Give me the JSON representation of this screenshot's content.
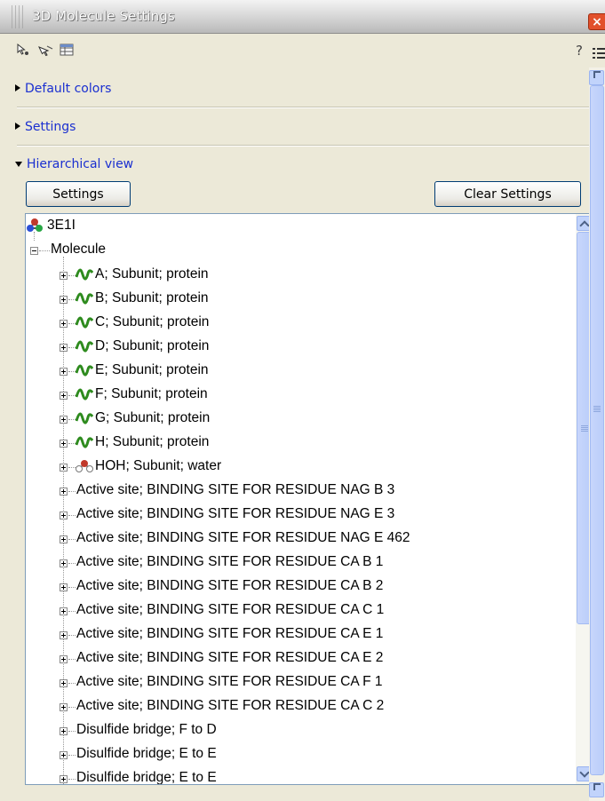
{
  "window": {
    "title": "3D Molecule Settings",
    "close_label": "×"
  },
  "toolbar": {
    "help_label": "?",
    "icons": [
      "pointer-select-icon",
      "pointer-drag-icon",
      "table-view-icon"
    ]
  },
  "sections": {
    "default_colors": "Default colors",
    "settings": "Settings",
    "hierarchical_view": "Hierarchical view"
  },
  "buttons": {
    "settings": "Settings",
    "clear_settings": "Clear Settings"
  },
  "tree": {
    "root": "3E1I",
    "molecule": "Molecule",
    "items": [
      {
        "label": "A; Subunit; protein",
        "icon": "protein-chain-icon"
      },
      {
        "label": "B; Subunit; protein",
        "icon": "protein-chain-icon"
      },
      {
        "label": "C; Subunit; protein",
        "icon": "protein-chain-icon"
      },
      {
        "label": "D; Subunit; protein",
        "icon": "protein-chain-icon"
      },
      {
        "label": "E; Subunit; protein",
        "icon": "protein-chain-icon"
      },
      {
        "label": "F; Subunit; protein",
        "icon": "protein-chain-icon"
      },
      {
        "label": "G; Subunit; protein",
        "icon": "protein-chain-icon"
      },
      {
        "label": "H; Subunit; protein",
        "icon": "protein-chain-icon"
      },
      {
        "label": "HOH; Subunit; water",
        "icon": "water-molecule-icon"
      },
      {
        "label": "Active site; BINDING SITE FOR RESIDUE NAG B 3",
        "icon": ""
      },
      {
        "label": "Active site; BINDING SITE FOR RESIDUE NAG E 3",
        "icon": ""
      },
      {
        "label": "Active site; BINDING SITE FOR RESIDUE NAG E 462",
        "icon": ""
      },
      {
        "label": "Active site; BINDING SITE FOR RESIDUE CA B 1",
        "icon": ""
      },
      {
        "label": "Active site; BINDING SITE FOR RESIDUE CA B 2",
        "icon": ""
      },
      {
        "label": "Active site; BINDING SITE FOR RESIDUE CA C 1",
        "icon": ""
      },
      {
        "label": "Active site; BINDING SITE FOR RESIDUE CA E 1",
        "icon": ""
      },
      {
        "label": "Active site; BINDING SITE FOR RESIDUE CA E 2",
        "icon": ""
      },
      {
        "label": "Active site; BINDING SITE FOR RESIDUE CA F 1",
        "icon": ""
      },
      {
        "label": "Active site; BINDING SITE FOR RESIDUE CA C 2",
        "icon": ""
      },
      {
        "label": "Disulfide bridge; F to D",
        "icon": ""
      },
      {
        "label": "Disulfide bridge; E to E",
        "icon": ""
      },
      {
        "label": "Disulfide bridge; E to E",
        "icon": ""
      }
    ]
  },
  "colors": {
    "link_blue": "#1a2fd0",
    "protein_green": "#2e8b1e",
    "atom_red": "#c0392b",
    "atom_blue": "#2c4fd6",
    "close_red": "#e2502b"
  }
}
